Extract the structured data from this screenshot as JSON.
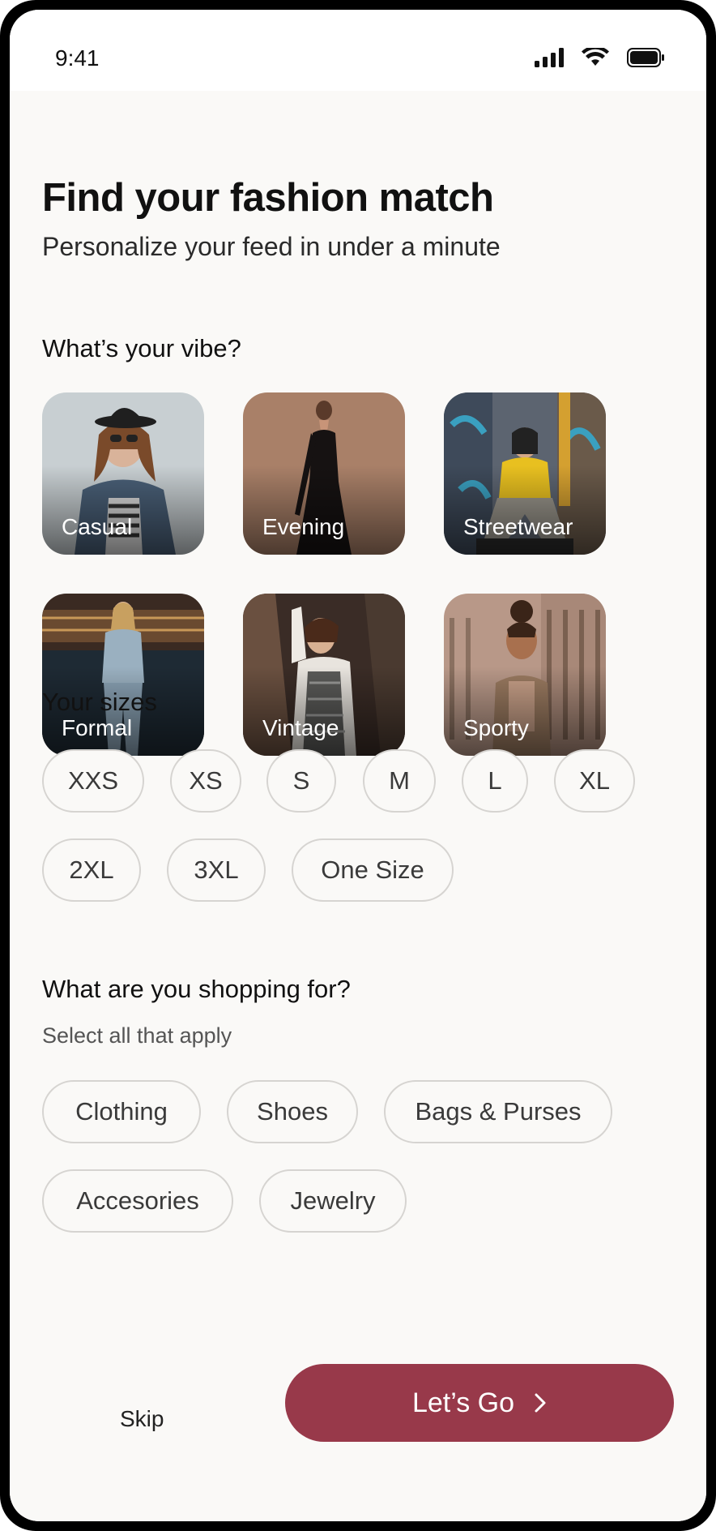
{
  "status": {
    "time": "9:41"
  },
  "header": {
    "title": "Find your fashion match",
    "subtitle": "Personalize your feed in under a minute"
  },
  "vibe": {
    "label": "What’s your vibe?",
    "options": [
      {
        "label": "Casual"
      },
      {
        "label": "Evening"
      },
      {
        "label": "Streetwear"
      },
      {
        "label": "Formal"
      },
      {
        "label": "Vintage"
      },
      {
        "label": "Sporty"
      }
    ]
  },
  "sizes": {
    "label": "Your sizes",
    "options": [
      "XXS",
      "XS",
      "S",
      "M",
      "L",
      "XL",
      "2XL",
      "3XL",
      "One Size"
    ]
  },
  "shopping": {
    "label": "What are you shopping for?",
    "helper": "Select all that apply",
    "options": [
      "Clothing",
      "Shoes",
      "Bags & Purses",
      "Accesories",
      "Jewelry"
    ]
  },
  "footer": {
    "skip_label": "Skip",
    "go_label": "Let’s Go"
  },
  "colors": {
    "accent": "#98394a",
    "background": "#faf9f7",
    "chip_border": "#d6d4d1"
  },
  "icons": [
    "signal-icon",
    "wifi-icon",
    "battery-icon",
    "chevron-right-icon"
  ]
}
